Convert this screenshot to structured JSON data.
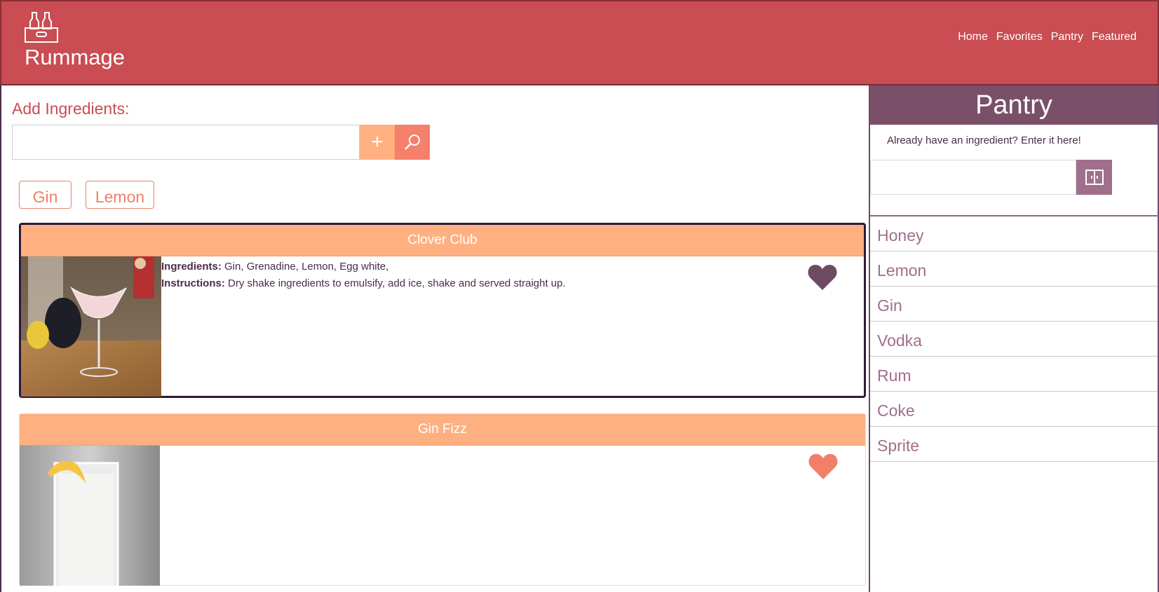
{
  "header": {
    "brand": "Rummage",
    "logo_icon": "bottle-crate-icon",
    "nav": [
      "Home",
      "Favorites",
      "Pantry",
      "Featured"
    ]
  },
  "main": {
    "add_title": "Add Ingredients:",
    "input_value": "",
    "add_button_icon": "plus-icon",
    "search_button_icon": "search-icon",
    "chips": [
      "Gin",
      "Lemon"
    ]
  },
  "cards": [
    {
      "title": "Clover Club",
      "ingredients_label": "Ingredients:",
      "ingredients": " Gin, Grenadine, Lemon, Egg white,",
      "instructions_label": "Instructions:",
      "instructions": " Dry shake ingredients to emulsify, add ice, shake and served straight up.",
      "favorite": true,
      "heart_color": "#6e4a63"
    },
    {
      "title": "Gin Fizz",
      "ingredients_label": "",
      "ingredients": "",
      "instructions_label": "",
      "instructions": "",
      "favorite": false,
      "heart_color": "#f0806a"
    }
  ],
  "pantry": {
    "title": "Pantry",
    "subtitle": "Already have an ingredient? Enter it here!",
    "input_value": "",
    "button_icon": "pantry-door-icon",
    "items": [
      "Honey",
      "Lemon",
      "Gin",
      "Vodka",
      "Rum",
      "Coke",
      "Sprite"
    ]
  },
  "colors": {
    "header": "#c94d52",
    "card_header": "#ffb081",
    "accent": "#f0806a",
    "pantry_header": "#7a5068",
    "pantry_item": "#a06f8b"
  }
}
